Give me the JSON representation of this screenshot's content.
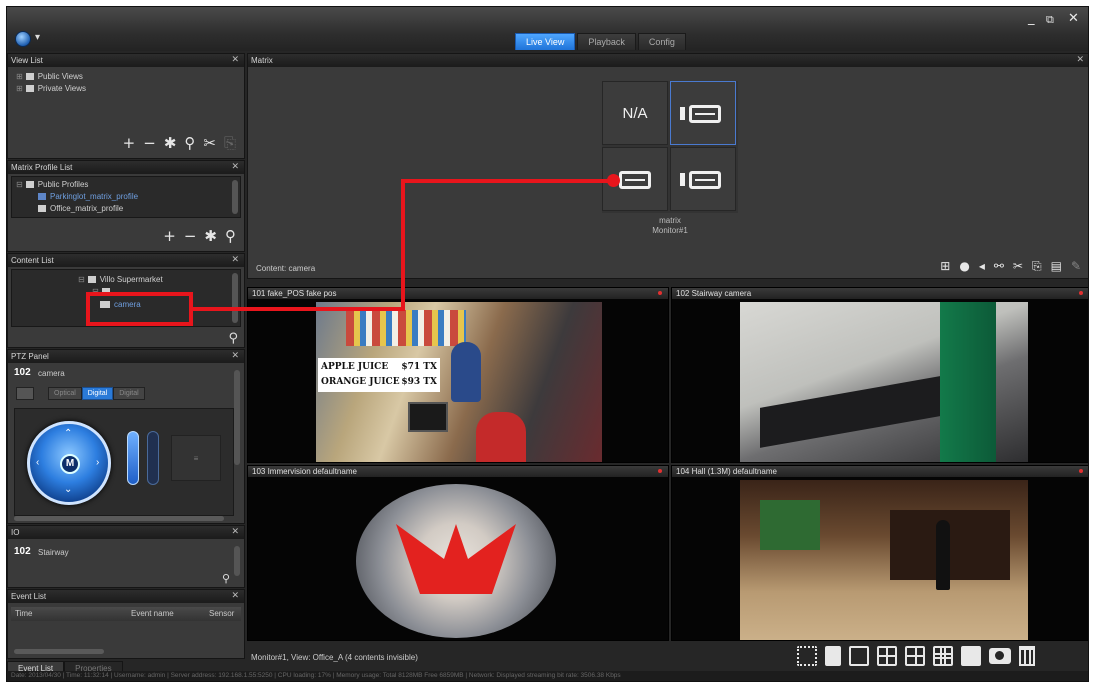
{
  "main_tabs": [
    "Live View",
    "Playback",
    "Config"
  ],
  "window_controls": {
    "minimize": "_",
    "restore": "⧉",
    "close": "✕"
  },
  "view_list": {
    "title": "View List",
    "items": [
      "Public Views",
      "Private Views"
    ]
  },
  "matrix_profile_list": {
    "title": "Matrix Profile List",
    "items": [
      "Public Profiles",
      "Parkinglot_matrix_profile",
      "Office_matrix_profile"
    ]
  },
  "content_list": {
    "title": "Content List",
    "items": [
      "Villo Supermarket",
      "camera"
    ]
  },
  "ptz_panel": {
    "title": "PTZ Panel",
    "camera": "102",
    "camera_label": "camera",
    "modes": [
      "Optical",
      "Digital",
      "Digital"
    ],
    "center_label": "M"
  },
  "io_panel": {
    "title": "IO",
    "camera": "102",
    "camera_label": "Stairway"
  },
  "event_list": {
    "title": "Event List",
    "columns": [
      "Time",
      "Event name",
      "Sensor"
    ]
  },
  "left_tabs": [
    "Event List",
    "Properties"
  ],
  "matrix": {
    "title": "Matrix",
    "cells": [
      "N/A",
      "",
      "",
      ""
    ],
    "label": "matrix",
    "monitor": "Monitor#1",
    "content_label": "Content: camera"
  },
  "viewports": [
    {
      "title": "101 fake_POS fake pos"
    },
    {
      "title": "102 Stairway camera"
    },
    {
      "title": "103 Immervision defaultname"
    },
    {
      "title": "104 Hall (1.3M) defaultname"
    }
  ],
  "pos_overlay": [
    {
      "item": "APPLE JUICE",
      "price": "$71 TX"
    },
    {
      "item": "ORANGE JUICE",
      "price": "$93 TX"
    }
  ],
  "status": {
    "footer_left": "Monitor#1, View: Office_A (4 contents invisible)",
    "bottom": "Date: 2013/04/30  |  Time: 11:32:14  |  Username: admin  |  Server address: 192.168.1.55:5250  |  CPU loading: 17%  |  Memory usage: Total 8128MB Free 6859MB  |  Network: Displayed streaming bit rate: 3506.38 Kbps"
  }
}
